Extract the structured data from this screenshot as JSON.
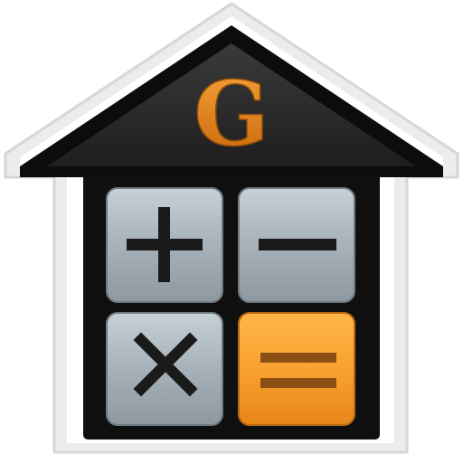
{
  "icon": {
    "logo_letter": "G",
    "keys": [
      {
        "name": "plus-key",
        "icon": "plus-icon"
      },
      {
        "name": "minus-key",
        "icon": "minus-icon"
      },
      {
        "name": "multiply-key",
        "icon": "multiply-icon"
      },
      {
        "name": "equals-key",
        "icon": "equals-icon"
      }
    ]
  },
  "colors": {
    "outline": "#e9e9e9",
    "house_body": "#0f0f0f",
    "roof": "#2b2b2b",
    "logo_orange": "#e07a10",
    "key_gray": "#a7b2ba",
    "key_orange": "#f7a12f",
    "symbol_dark": "#1a1a1a",
    "symbol_brown": "#8a4e12"
  }
}
